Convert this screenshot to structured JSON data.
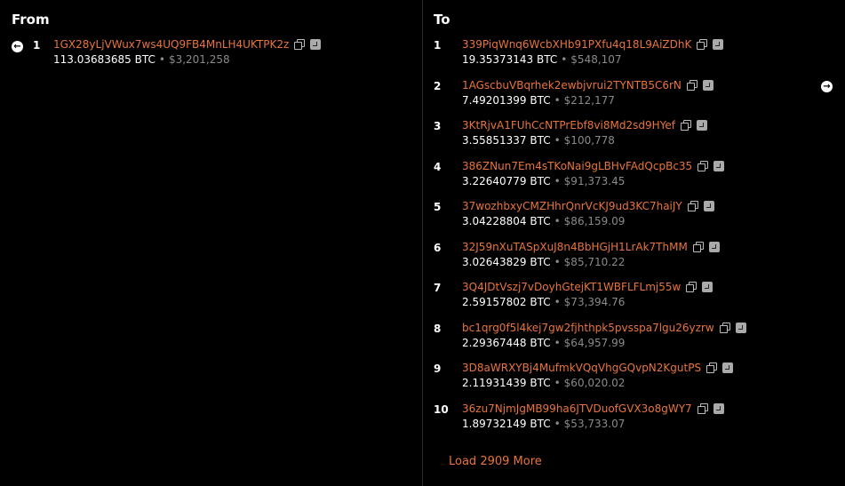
{
  "from": {
    "title": "From",
    "items": [
      {
        "index": "1",
        "address": "1GX28yLjVWux7ws4UQ9FB4MnLH4UKTPK2z",
        "btc": "113.03683685 BTC",
        "usd": "$3,201,258"
      }
    ]
  },
  "to": {
    "title": "To",
    "items": [
      {
        "index": "1",
        "address": "339PiqWnq6WcbXHb91PXfu4q18L9AiZDhK",
        "btc": "19.35373143 BTC",
        "usd": "$548,107"
      },
      {
        "index": "2",
        "address": "1AGscbuVBqrhek2ewbjvrui2TYNTB5C6rN",
        "btc": "7.49201399 BTC",
        "usd": "$212,177"
      },
      {
        "index": "3",
        "address": "3KtRjvA1FUhCcNTPrEbf8vi8Md2sd9HYef",
        "btc": "3.55851337 BTC",
        "usd": "$100,778"
      },
      {
        "index": "4",
        "address": "386ZNun7Em4sTKoNai9gLBHvFAdQcpBc35",
        "btc": "3.22640779 BTC",
        "usd": "$91,373.45"
      },
      {
        "index": "5",
        "address": "37wozhbxyCMZHhrQnrVcKJ9ud3KC7haiJY",
        "btc": "3.04228804 BTC",
        "usd": "$86,159.09"
      },
      {
        "index": "6",
        "address": "32J59nXuTASpXuJ8n4BbHGjH1LrAk7ThMM",
        "btc": "3.02643829 BTC",
        "usd": "$85,710.22"
      },
      {
        "index": "7",
        "address": "3Q4JDtVszj7vDoyhGtejKT1WBFLFLmj55w",
        "btc": "2.59157802 BTC",
        "usd": "$73,394.76"
      },
      {
        "index": "8",
        "address": "bc1qrg0f5l4kej7gw2fjhthpk5pvsspa7lgu26yzrw",
        "btc": "2.29367448 BTC",
        "usd": "$64,957.99"
      },
      {
        "index": "9",
        "address": "3D8aWRXYBj4MufmkVQqVhgGQvpN2KgutPS",
        "btc": "2.11931439 BTC",
        "usd": "$60,020.02"
      },
      {
        "index": "10",
        "address": "36zu7NjmJgMB99ha6JTVDuofGVX3o8gWY7",
        "btc": "1.89732149 BTC",
        "usd": "$53,733.07"
      }
    ],
    "load_more": "Load 2909 More"
  },
  "separator": "•",
  "icons": {
    "prev": "arrow-left-icon",
    "next": "arrow-right-icon",
    "copy": "copy-icon",
    "explorer": "explorer-icon"
  }
}
